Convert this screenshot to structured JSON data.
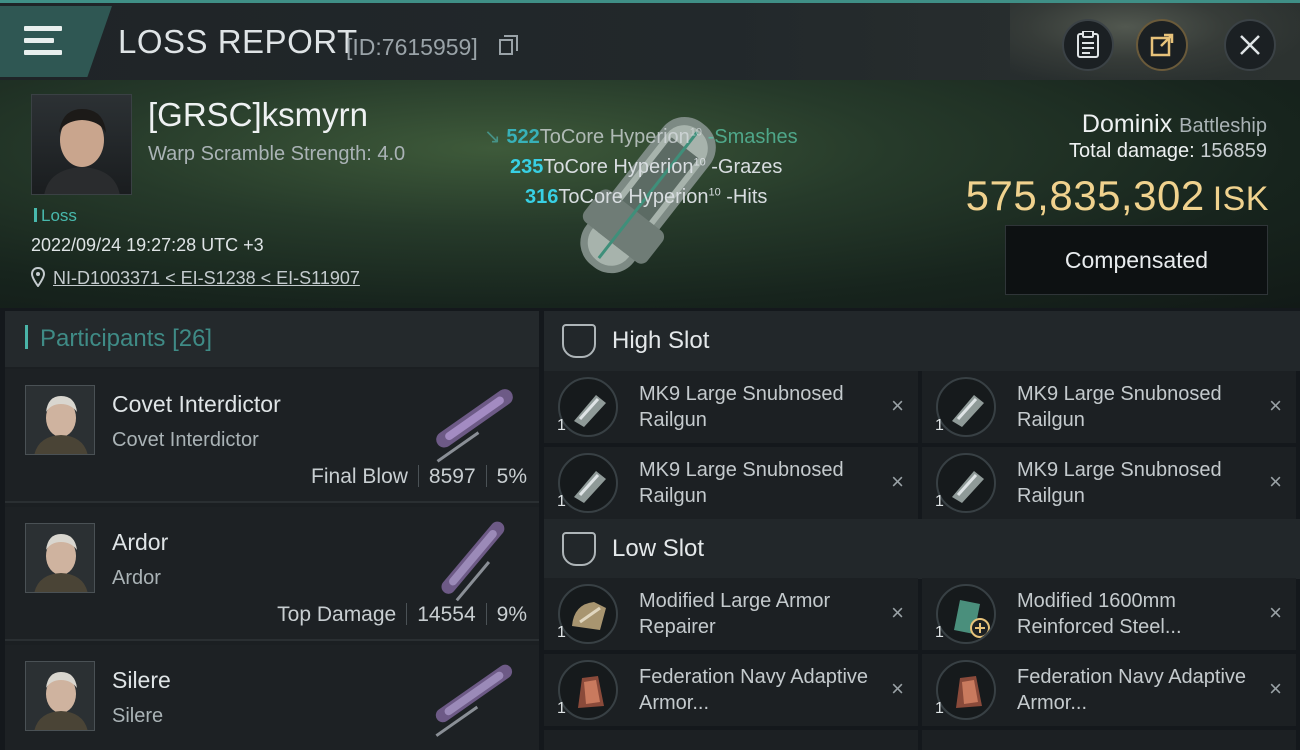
{
  "header": {
    "title": "LOSS REPORT",
    "report_id": "[ID:7615959]"
  },
  "victim": {
    "name": "[GRSC]ksmyrn",
    "warp_scramble": "Warp Scramble Strength: 4.0",
    "status": "Loss",
    "datetime": "2022/09/24 19:27:28 UTC +3",
    "location": "NI-D1003371 < EI-S1238 < EI-S11907"
  },
  "hits": [
    {
      "value": "522",
      "weapon": "ToCore Hyperion",
      "level": "10",
      "type": "-Smashes"
    },
    {
      "value": "235",
      "weapon": "ToCore Hyperion",
      "level": "10",
      "type": "-Grazes"
    },
    {
      "value": "316",
      "weapon": "ToCore Hyperion",
      "level": "10",
      "type": "-Hits"
    }
  ],
  "ship": {
    "name": "Dominix",
    "class": "Battleship",
    "total_damage_label": "Total damage:",
    "total_damage": "156859",
    "isk_value": "575,835,302",
    "isk_unit": "ISK",
    "compensated_label": "Compensated"
  },
  "participants": {
    "title": "Participants",
    "count": "[26]",
    "rows": [
      {
        "name": "Covet Interdictor",
        "ship": "Covet Interdictor",
        "label": "Final Blow",
        "damage": "8597",
        "percent": "5%"
      },
      {
        "name": "Ardor",
        "ship": "Ardor",
        "label": "Top Damage",
        "damage": "14554",
        "percent": "9%"
      },
      {
        "name": "Silere",
        "ship": "Silere",
        "label": "",
        "damage": "",
        "percent": ""
      }
    ]
  },
  "high_slot": {
    "title": "High Slot",
    "items": [
      {
        "name": "MK9 Large Snubnosed Railgun",
        "qty": "1"
      },
      {
        "name": "MK9 Large Snubnosed Railgun",
        "qty": "1"
      },
      {
        "name": "MK9 Large Snubnosed Railgun",
        "qty": "1"
      },
      {
        "name": "MK9 Large Snubnosed Railgun",
        "qty": "1"
      }
    ]
  },
  "low_slot": {
    "title": "Low Slot",
    "items": [
      {
        "name": "Modified Large Armor Repairer",
        "qty": "1"
      },
      {
        "name": "Modified 1600mm Reinforced Steel...",
        "qty": "1"
      },
      {
        "name": "Federation Navy Adaptive Armor...",
        "qty": "1"
      },
      {
        "name": "Federation Navy Adaptive Armor...",
        "qty": "1"
      }
    ]
  },
  "icons": {
    "close": "×"
  }
}
